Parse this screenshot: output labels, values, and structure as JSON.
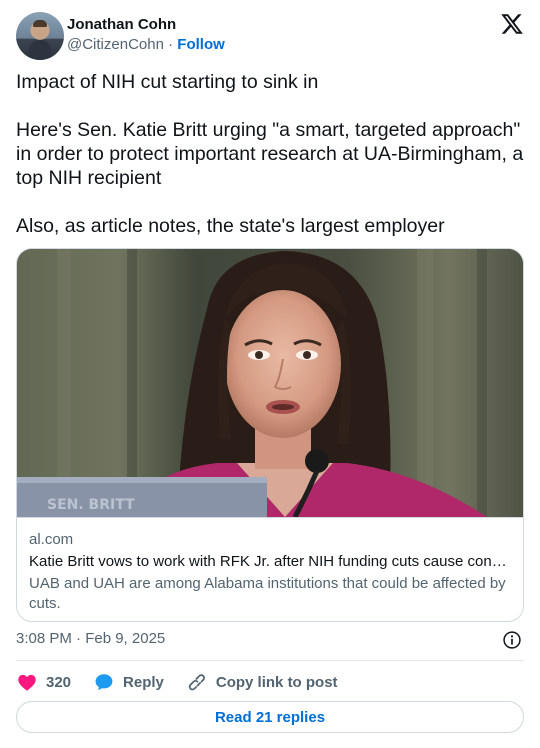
{
  "author": {
    "name": "Jonathan Cohn",
    "handle": "@CitizenCohn",
    "separator": "·",
    "follow_label": "Follow"
  },
  "tweet": {
    "text": "Impact of NIH cut starting to sink in\n\nHere's Sen. Katie Britt urging \"a smart, targeted approach\" in order to protect important research at UA-Birmingham, a top NIH recipient\n\nAlso, as article notes, the state's largest employer"
  },
  "link_card": {
    "domain": "al.com",
    "title": "Katie Britt vows to work with RFK Jr. after NIH funding cuts cause conc…",
    "description": "UAB and UAH are among Alabama institutions that could be affected by cuts.",
    "image_nameplate": "SEN. BRITT"
  },
  "timestamp": "3:08 PM · Feb 9, 2025",
  "actions": {
    "like_count": "320",
    "reply_label": "Reply",
    "copy_label": "Copy link to post"
  },
  "read_replies_label": "Read 21 replies",
  "colors": {
    "accent": "#006fd6",
    "like": "#f91880",
    "reply_bubble": "#1d9bf0",
    "muted": "#536471",
    "text": "#0f1419"
  }
}
